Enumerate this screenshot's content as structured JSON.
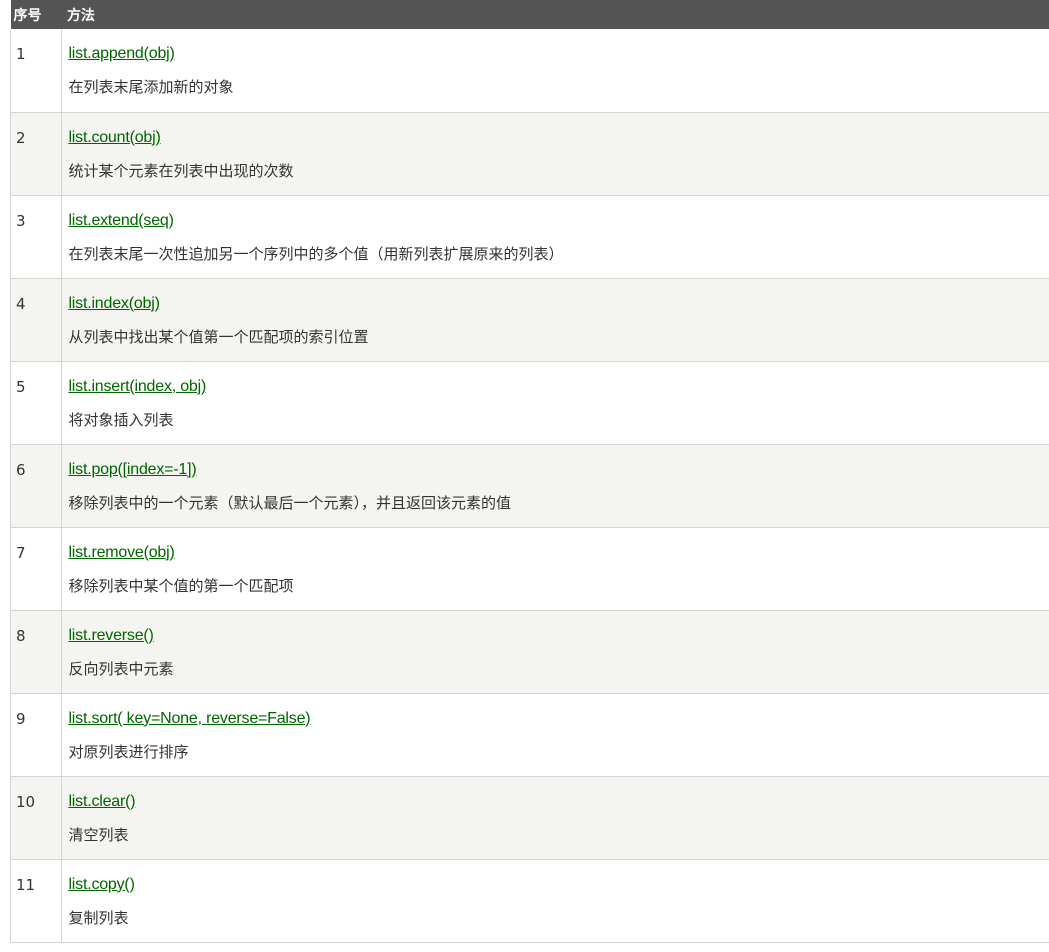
{
  "header": {
    "col_number": "序号",
    "col_method": "方法"
  },
  "colors": {
    "header_bg": "#555555",
    "link": "#006600",
    "alt_row_bg": "#f4f4f0"
  },
  "rows": [
    {
      "number": "1",
      "method": "list.append(obj)",
      "description": "在列表末尾添加新的对象"
    },
    {
      "number": "2",
      "method": "list.count(obj)",
      "description": "统计某个元素在列表中出现的次数"
    },
    {
      "number": "3",
      "method": "list.extend(seq)",
      "description": "在列表末尾一次性追加另一个序列中的多个值（用新列表扩展原来的列表）"
    },
    {
      "number": "4",
      "method": "list.index(obj)",
      "description": "从列表中找出某个值第一个匹配项的索引位置"
    },
    {
      "number": "5",
      "method": "list.insert(index, obj)",
      "description": "将对象插入列表"
    },
    {
      "number": "6",
      "method": "list.pop([index=-1])",
      "description": "移除列表中的一个元素（默认最后一个元素），并且返回该元素的值"
    },
    {
      "number": "7",
      "method": "list.remove(obj)",
      "description": "移除列表中某个值的第一个匹配项"
    },
    {
      "number": "8",
      "method": "list.reverse()",
      "description": "反向列表中元素"
    },
    {
      "number": "9",
      "method": "list.sort( key=None, reverse=False)",
      "description": "对原列表进行排序"
    },
    {
      "number": "10",
      "method": "list.clear()",
      "description": "清空列表"
    },
    {
      "number": "11",
      "method": "list.copy()",
      "description": "复制列表"
    }
  ]
}
